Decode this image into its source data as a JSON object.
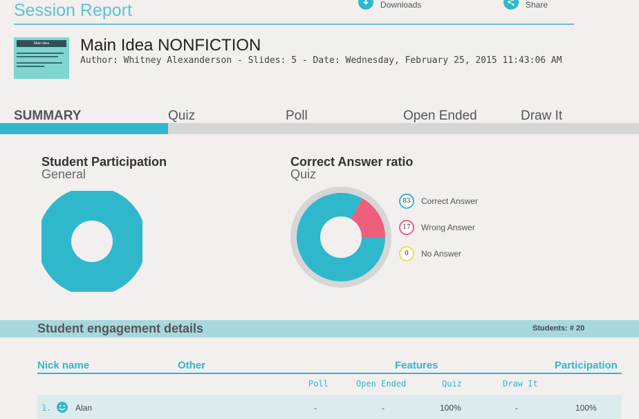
{
  "header": {
    "title": "Session Report",
    "downloads_label": "Downloads",
    "share_label": "Share"
  },
  "presentation": {
    "thumbnail_title": "Main Idea",
    "title": "Main Idea NONFICTION",
    "meta": "Author: Whitney Alexanderson - Slides: 5 - Date: Wednesday, February 25, 2015 11:43:06 AM"
  },
  "tabs": [
    "SUMMARY",
    "Quiz",
    "Poll",
    "Open Ended",
    "Draw It"
  ],
  "participation": {
    "title": "Student Participation",
    "subtitle": "General"
  },
  "ratio": {
    "title": "Correct Answer ratio",
    "subtitle": "Quiz",
    "legend": [
      {
        "value": "83",
        "label": "Correct Answer",
        "color": "#2fb8cc"
      },
      {
        "value": "17",
        "label": "Wrong Answer",
        "color": "#ee5f7b"
      },
      {
        "value": "0",
        "label": "No Answer",
        "color": "#f2d94e"
      }
    ]
  },
  "engagement": {
    "title": "Student engagement details",
    "students": "Students: # 20",
    "columns": {
      "nick": "Nick name",
      "other": "Other",
      "features": "Features",
      "participation": "Participation"
    },
    "features": {
      "poll": "Poll",
      "open_ended": "Open Ended",
      "quiz": "Quiz",
      "draw_it": "Draw It"
    },
    "rows": [
      {
        "index": "1.",
        "name": "Alan",
        "poll": "-",
        "open_ended": "-",
        "quiz": "100%",
        "draw_it": "-",
        "participation": "100%"
      }
    ]
  },
  "colors": {
    "accent": "#2fb8cc",
    "wrong": "#ee5f7b",
    "none": "#f2d94e",
    "ring": "#d6d6d6"
  }
}
